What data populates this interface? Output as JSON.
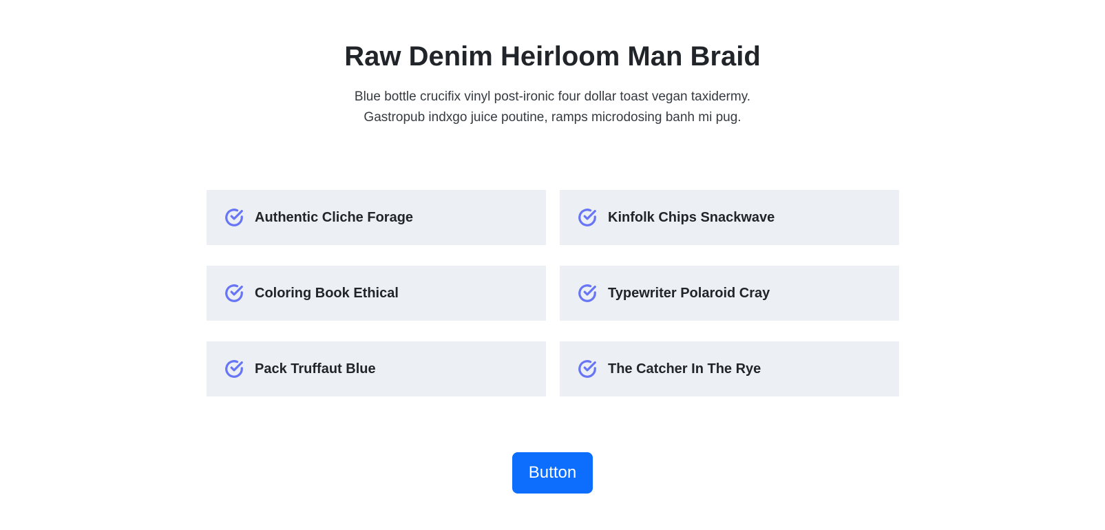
{
  "header": {
    "title": "Raw Denim Heirloom Man Braid",
    "subtitle_line1": "Blue bottle crucifix vinyl post-ironic four dollar toast vegan taxidermy.",
    "subtitle_line2": "Gastropub indxgo juice poutine, ramps microdosing banh mi pug."
  },
  "features": [
    {
      "label": "Authentic Cliche Forage",
      "icon": "check-circle-icon"
    },
    {
      "label": "Kinfolk Chips Snackwave",
      "icon": "check-circle-icon"
    },
    {
      "label": "Coloring Book Ethical",
      "icon": "check-circle-icon"
    },
    {
      "label": "Typewriter Polaroid Cray",
      "icon": "check-circle-icon"
    },
    {
      "label": "Pack Truffaut Blue",
      "icon": "check-circle-icon"
    },
    {
      "label": "The Catcher In The Rye",
      "icon": "check-circle-icon"
    }
  ],
  "cta": {
    "label": "Button"
  },
  "colors": {
    "accent": "#6875f5",
    "button": "#0d6efd",
    "card_bg": "#ecf0f5",
    "text": "#212529"
  }
}
